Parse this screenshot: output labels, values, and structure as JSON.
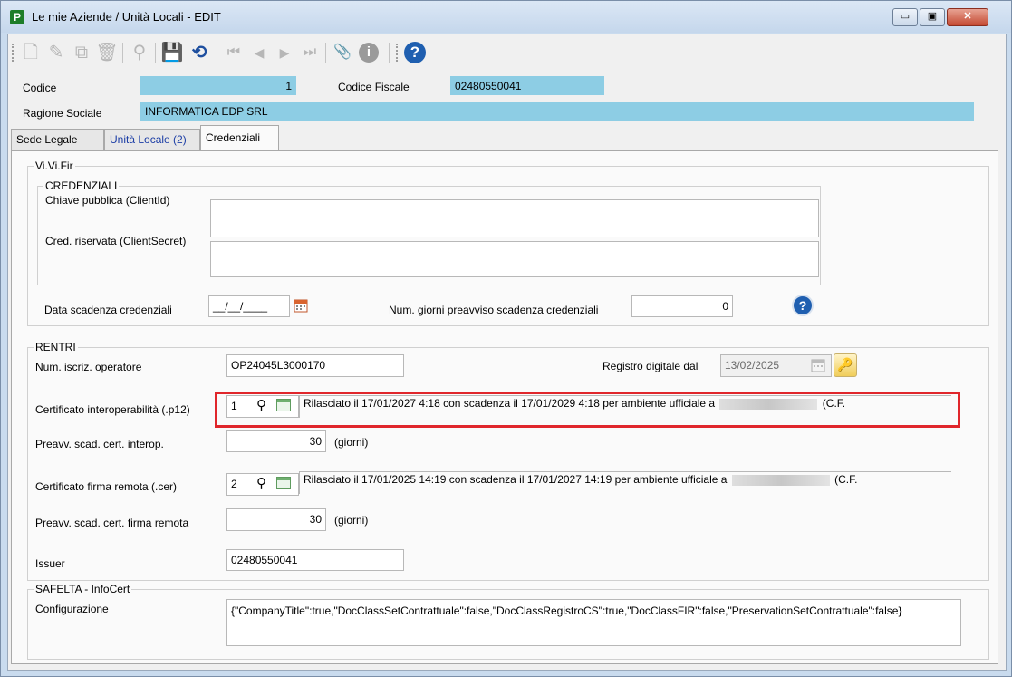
{
  "window": {
    "title": "Le mie Aziende / Unità Locali - EDIT",
    "app_icon_letter": "P"
  },
  "window_buttons": {
    "minimize": "▭",
    "maximize": "▣",
    "close": "✕"
  },
  "toolbar": {
    "icons": [
      "new-icon",
      "edit-icon",
      "copy-icon",
      "delete-icon",
      "search-icon",
      "save-icon",
      "undo-icon",
      "first-record-icon",
      "previous-record-icon",
      "next-record-icon",
      "last-record-icon",
      "attachment-icon",
      "info-icon",
      "help-icon"
    ],
    "glyphs": {
      "new": "🗋",
      "edit": "✎",
      "copy": "⧉",
      "delete": "🗑",
      "search": "⚲",
      "save": "💾",
      "undo": "⟲",
      "first": "⏮",
      "prev": "◀",
      "next": "▶",
      "last": "⏭",
      "attach": "📎",
      "info": "i",
      "help": "?"
    }
  },
  "header": {
    "codice_label": "Codice",
    "codice_value": "1",
    "codice_fiscale_label": "Codice Fiscale",
    "codice_fiscale_value": "02480550041",
    "ragione_sociale_label": "Ragione Sociale",
    "ragione_sociale_value": "INFORMATICA EDP SRL"
  },
  "tabs": [
    {
      "label": "Sede Legale"
    },
    {
      "label": "Unità Locale (2)"
    },
    {
      "label": "Credenziali"
    }
  ],
  "vivifir": {
    "group_label": "Vi.Vi.Fir",
    "credenziali_label": "CREDENZIALI",
    "client_id_label": "Chiave pubblica (ClientId)",
    "client_id_value": "",
    "client_secret_label": "Cred. riservata (ClientSecret)",
    "client_secret_value": "",
    "data_scadenza_label": "Data scadenza credenziali",
    "data_scadenza_value": "__/__/____",
    "giorni_preavviso_label": "Num. giorni preavviso scadenza credenziali",
    "giorni_preavviso_value": "0",
    "help_glyph": "?"
  },
  "rentri": {
    "group_label": "RENTRI",
    "num_iscriz_label": "Num. iscriz. operatore",
    "num_iscriz_value": "OP24045L3000170",
    "registro_label": "Registro digitale dal",
    "registro_value": "13/02/2025",
    "key_glyph": "🔑",
    "cert_interop_label": "Certificato interoperabilità (.p12)",
    "cert_interop_number": "1",
    "cert_interop_text": "Rilasciato il 17/01/2027   4:18 con scadenza il 17/01/2029   4:18 per ambiente ufficiale a",
    "cert_interop_tail": "(C.F.",
    "preavv_interop_label": "Preavv. scad. cert. interop.",
    "preavv_interop_value": "30",
    "giorni_unit": "(giorni)",
    "cert_firma_label": "Certificato firma remota (.cer)",
    "cert_firma_number": "2",
    "cert_firma_text": "Rilasciato il 17/01/2025 14:19 con scadenza il 17/01/2027 14:19 per ambiente ufficiale a",
    "cert_firma_tail": "(C.F.",
    "preavv_firma_label": "Preavv. scad. cert. firma remota",
    "preavv_firma_value": "30",
    "issuer_label": "Issuer",
    "issuer_value": "02480550041"
  },
  "safelta": {
    "group_label": "SAFELTA - InfoCert",
    "config_label": "Configurazione",
    "config_value": "{\"CompanyTitle\":true,\"DocClassSetContrattuale\":false,\"DocClassRegistroCS\":true,\"DocClassFIR\":false,\"PreservationSetContrattuale\":false}"
  },
  "colors": {
    "accent_field": "#8dcde4",
    "highlight": "#e0262b",
    "window_frame": "#c9dbee"
  }
}
